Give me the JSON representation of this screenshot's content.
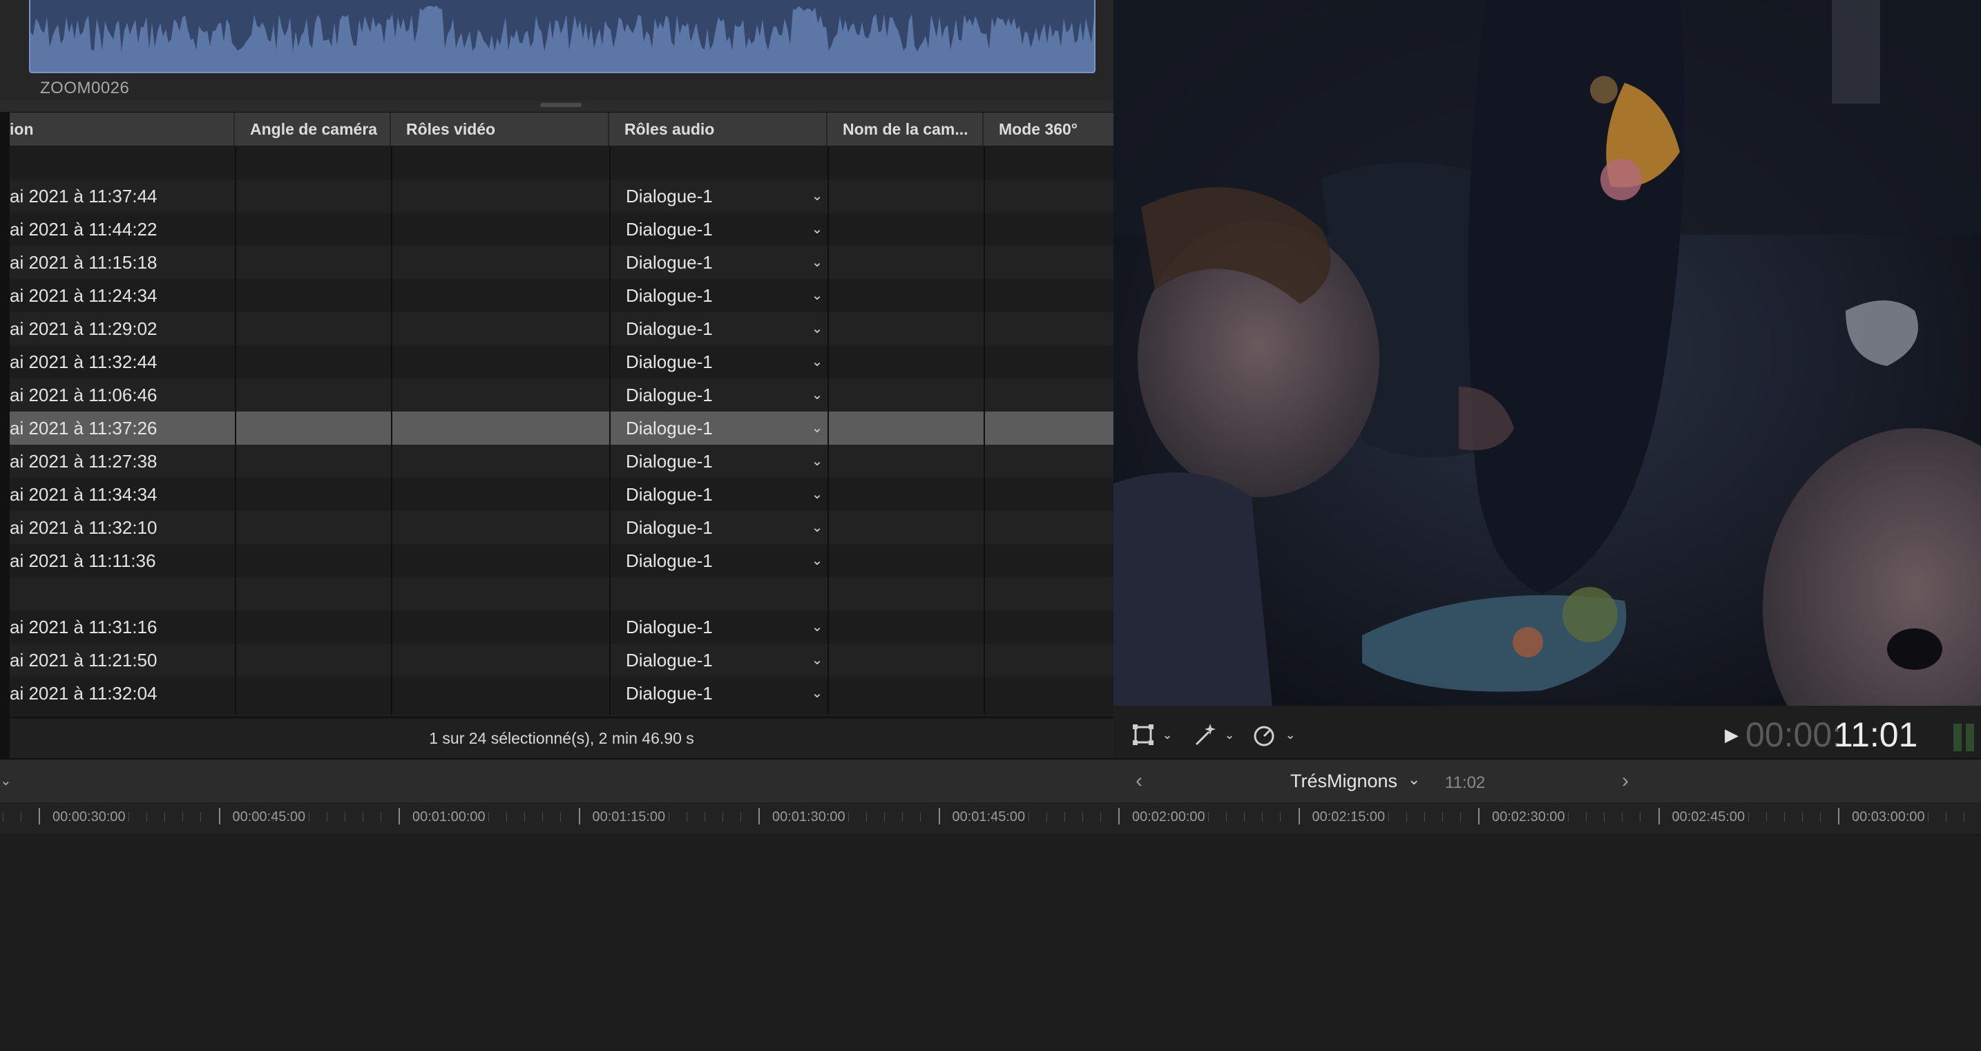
{
  "browser": {
    "clip_name": "ZOOM0026",
    "columns": [
      {
        "key": "date",
        "label": "ion"
      },
      {
        "key": "angle",
        "label": "Angle de caméra"
      },
      {
        "key": "video_roles",
        "label": "Rôles vidéo"
      },
      {
        "key": "audio_roles",
        "label": "Rôles audio"
      },
      {
        "key": "camera_name",
        "label": "Nom de la cam..."
      },
      {
        "key": "mode360",
        "label": "Mode 360°"
      }
    ],
    "rows": [
      {
        "date": "",
        "audio": ""
      },
      {
        "date": "ai 2021 à 11:37:44",
        "audio": "Dialogue-1"
      },
      {
        "date": "ai 2021 à 11:44:22",
        "audio": "Dialogue-1"
      },
      {
        "date": "ai 2021 à 11:15:18",
        "audio": "Dialogue-1"
      },
      {
        "date": "ai 2021 à 11:24:34",
        "audio": "Dialogue-1"
      },
      {
        "date": "ai 2021 à 11:29:02",
        "audio": "Dialogue-1"
      },
      {
        "date": "ai 2021 à 11:32:44",
        "audio": "Dialogue-1"
      },
      {
        "date": "ai 2021 à 11:06:46",
        "audio": "Dialogue-1"
      },
      {
        "date": "ai 2021 à 11:37:26",
        "audio": "Dialogue-1",
        "selected": true
      },
      {
        "date": "ai 2021 à 11:27:38",
        "audio": "Dialogue-1"
      },
      {
        "date": "ai 2021 à 11:34:34",
        "audio": "Dialogue-1"
      },
      {
        "date": "ai 2021 à 11:32:10",
        "audio": "Dialogue-1"
      },
      {
        "date": "ai 2021 à 11:11:36",
        "audio": "Dialogue-1"
      },
      {
        "date": "",
        "audio": ""
      },
      {
        "date": "ai 2021 à 11:31:16",
        "audio": "Dialogue-1"
      },
      {
        "date": "ai 2021 à 11:21:50",
        "audio": "Dialogue-1"
      },
      {
        "date": "ai 2021 à 11:32:04",
        "audio": "Dialogue-1"
      }
    ],
    "status": "1 sur 24 sélectionné(s), 2 min 46.90 s"
  },
  "viewer": {
    "icons": [
      "transform-icon",
      "enhance-wand-icon",
      "speed-retime-icon"
    ],
    "timecode_dim": "00:00:",
    "timecode_bright": "11:01"
  },
  "timeline": {
    "project_name": "TrésMignons",
    "duration": "11:02",
    "ruler_labels": [
      "00:00:30:00",
      "00:00:45:00",
      "00:01:00:00",
      "00:01:15:00",
      "00:01:30:00",
      "00:01:45:00",
      "00:02:00:00",
      "00:02:15:00",
      "00:02:30:00",
      "00:02:45:00",
      "00:03:00:00"
    ]
  },
  "colors": {
    "waveform_fill": "#5c76a6",
    "selection_row": "#5c5c5c",
    "panel_bg": "#1c1c1c"
  }
}
